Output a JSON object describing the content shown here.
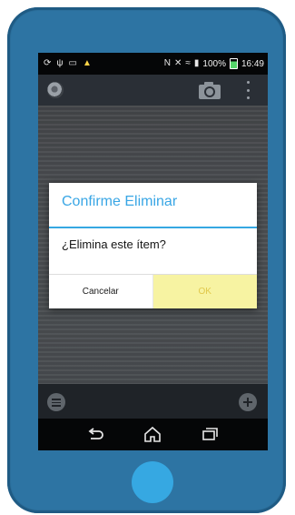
{
  "status_bar": {
    "battery": "100%",
    "time": "16:49"
  },
  "dialog": {
    "title": "Confirme Eliminar",
    "message": "¿Elimina este ítem?",
    "cancel_label": "Cancelar",
    "ok_label": "OK"
  },
  "colors": {
    "phone_body": "#2b6f9c",
    "accent": "#36a8e2",
    "ok_button_bg": "#f7f3a2"
  },
  "icons": [
    "sync-icon",
    "usb-icon",
    "screen-icon",
    "warning-icon",
    "nfc-icon",
    "mute-icon",
    "wifi-icon",
    "signal-icon",
    "battery-icon",
    "app-logo-icon",
    "camera-icon",
    "overflow-menu-icon",
    "list-icon",
    "add-icon",
    "back-icon",
    "home-icon",
    "recents-icon"
  ]
}
